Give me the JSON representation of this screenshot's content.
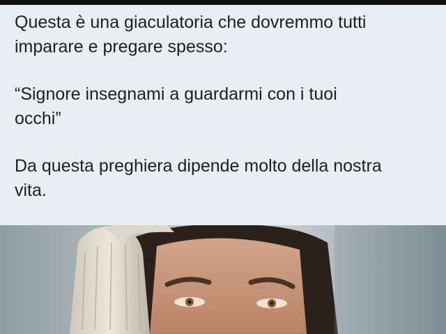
{
  "post": {
    "paragraph_1": "Questa è una giaculatoria che dovremmo tutti\nimparare e pregare spesso:",
    "paragraph_2": "“Signore insegnami a guardarmi con i tuoi\nocchi”",
    "paragraph_3": "Da questa preghiera dipende molto della nostra\nvita."
  },
  "colors": {
    "background": "#e9eef3",
    "text": "#1f1f1f",
    "top_bar": "#111111"
  },
  "image": {
    "subject": "man-with-towel-on-head"
  }
}
